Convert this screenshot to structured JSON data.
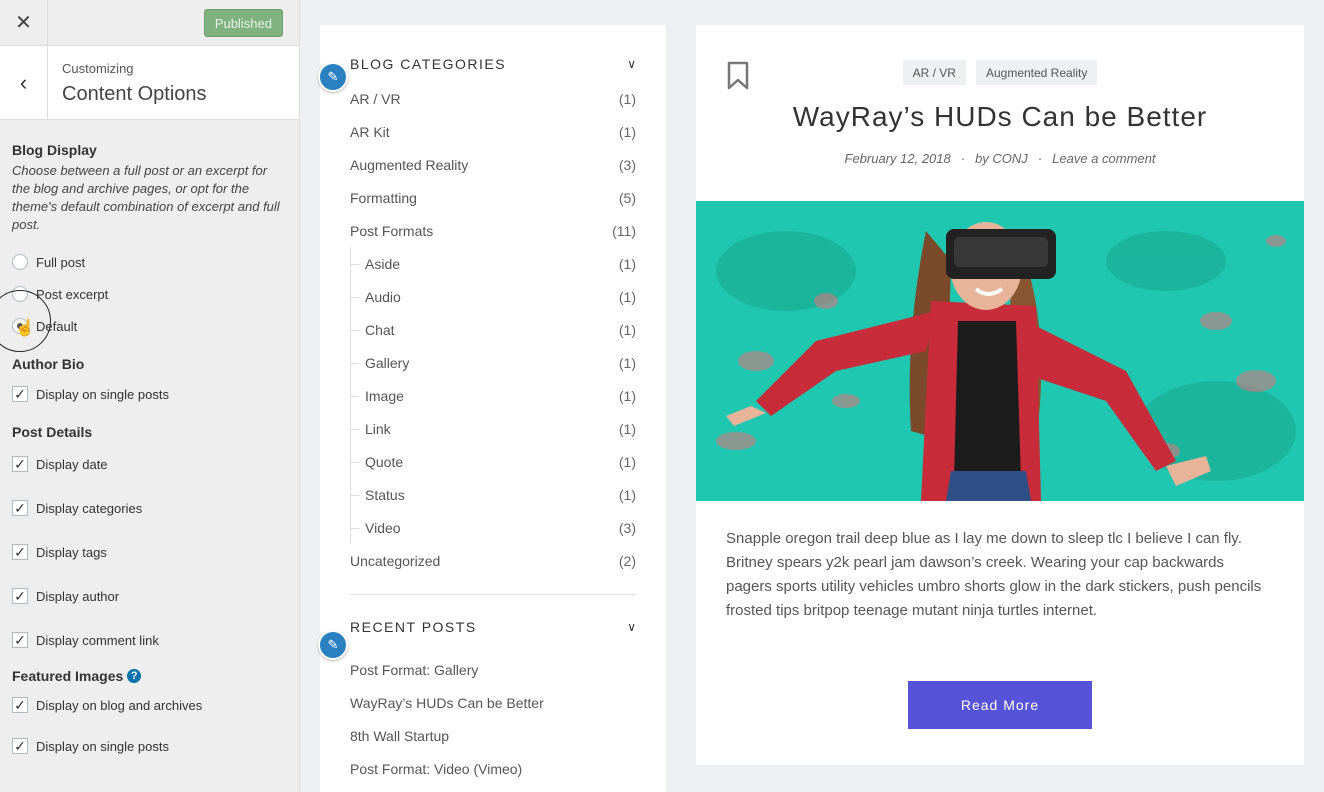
{
  "customizer": {
    "close_icon": "close-icon",
    "publish_label": "Published",
    "breadcrumb": "Customizing",
    "section_title": "Content Options",
    "blog_display": {
      "heading": "Blog Display",
      "description": "Choose between a full post or an excerpt for the blog and archive pages, or opt for the theme's default combination of excerpt and full post.",
      "options": [
        "Full post",
        "Post excerpt",
        "Default"
      ],
      "selected": "Default"
    },
    "author_bio": {
      "heading": "Author Bio",
      "option": "Display on single posts",
      "checked": true
    },
    "post_details": {
      "heading": "Post Details",
      "options": [
        "Display date",
        "Display categories",
        "Display tags",
        "Display author",
        "Display comment link"
      ]
    },
    "featured_images": {
      "heading": "Featured Images",
      "options": [
        "Display on blog and archives",
        "Display on single posts"
      ]
    }
  },
  "widgets": {
    "categories": {
      "title": "BLOG CATEGORIES",
      "items": [
        {
          "name": "AR / VR",
          "count": "(1)",
          "child": false
        },
        {
          "name": "AR Kit",
          "count": "(1)",
          "child": false
        },
        {
          "name": "Augmented Reality",
          "count": "(3)",
          "child": false
        },
        {
          "name": "Formatting",
          "count": "(5)",
          "child": false
        },
        {
          "name": "Post Formats",
          "count": "(11)",
          "child": false
        },
        {
          "name": "Aside",
          "count": "(1)",
          "child": true
        },
        {
          "name": "Audio",
          "count": "(1)",
          "child": true
        },
        {
          "name": "Chat",
          "count": "(1)",
          "child": true
        },
        {
          "name": "Gallery",
          "count": "(1)",
          "child": true
        },
        {
          "name": "Image",
          "count": "(1)",
          "child": true
        },
        {
          "name": "Link",
          "count": "(1)",
          "child": true
        },
        {
          "name": "Quote",
          "count": "(1)",
          "child": true
        },
        {
          "name": "Status",
          "count": "(1)",
          "child": true
        },
        {
          "name": "Video",
          "count": "(3)",
          "child": true
        },
        {
          "name": "Uncategorized",
          "count": "(2)",
          "child": false
        }
      ]
    },
    "recent": {
      "title": "RECENT POSTS",
      "items": [
        "Post Format: Gallery",
        "WayRay’s HUDs Can be Better",
        "8th Wall Startup",
        "Post Format: Video (Vimeo)"
      ]
    }
  },
  "post": {
    "tags": [
      "AR / VR",
      "Augmented Reality"
    ],
    "title": "WayRay’s HUDs Can be Better",
    "date": "February 12, 2018",
    "author": "by CONJ",
    "comment_link": "Leave a comment",
    "meta_separator": "·",
    "excerpt": "Snapple oregon trail deep blue as I lay me down to sleep tlc I believe I can fly. Britney spears y2k pearl jam dawson’s creek. Wearing your cap backwards pagers sports utility vehicles umbro shorts glow in the dark stickers, push pencils frosted tips britpop teenage mutant ninja turtles internet.",
    "read_more": "Read More"
  },
  "colors": {
    "publish_button": "#7fb27f",
    "edit_shortcut": "#2a80c0",
    "read_more": "#5653d9",
    "hero_bg": "#1fc7b0"
  }
}
